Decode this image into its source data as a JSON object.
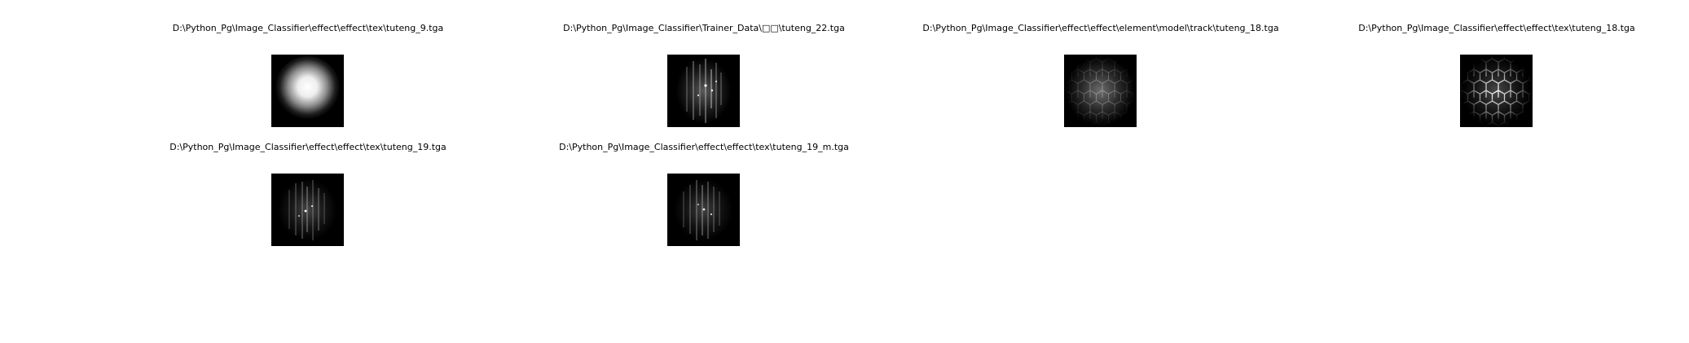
{
  "panels": [
    {
      "title": "D:\\Python_Pg\\Image_Classifier\\effect\\effect\\tex\\tuteng_9.tga",
      "thumbnail": "soft-white-glow-texture"
    },
    {
      "title": "D:\\Python_Pg\\Image_Classifier\\Trainer_Data\\□□\\tuteng_22.tga",
      "thumbnail": "sparkle-streak-texture"
    },
    {
      "title": "D:\\Python_Pg\\Image_Classifier\\effect\\effect\\element\\model\\track\\tuteng_18.tga",
      "thumbnail": "faint-hexagon-grid-texture"
    },
    {
      "title": "D:\\Python_Pg\\Image_Classifier\\effect\\effect\\tex\\tuteng_18.tga",
      "thumbnail": "bright-hexagon-grid-texture"
    },
    {
      "title": "D:\\Python_Pg\\Image_Classifier\\effect\\effect\\tex\\tuteng_19.tga",
      "thumbnail": "sparkle-streak-texture"
    },
    {
      "title": "D:\\Python_Pg\\Image_Classifier\\effect\\effect\\tex\\tuteng_19_m.tga",
      "thumbnail": "sparkle-streak-texture"
    }
  ]
}
